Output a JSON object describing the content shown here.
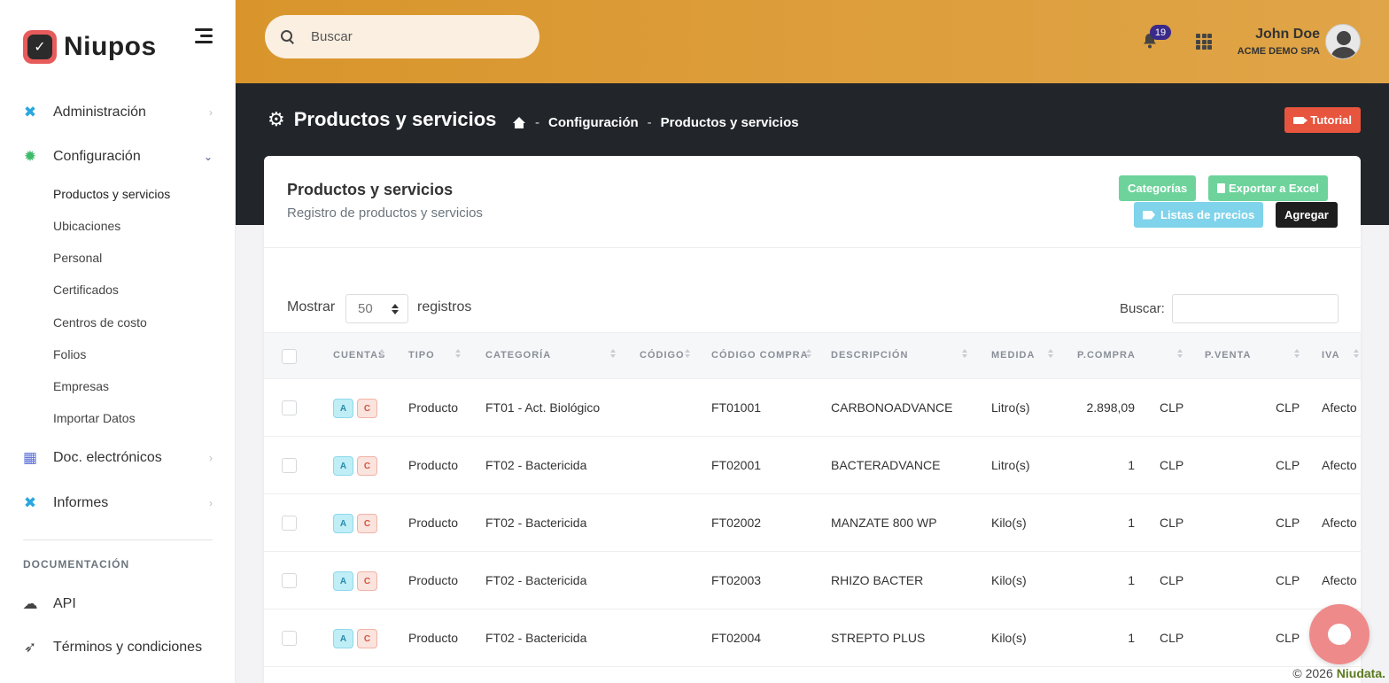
{
  "brand": {
    "name": "Niupos"
  },
  "search": {
    "placeholder": "Buscar"
  },
  "topbar": {
    "notifications": "19",
    "user_name": "John Doe",
    "user_company": "ACME DEMO SPA"
  },
  "sidebar": {
    "items": [
      {
        "label": "Administración"
      },
      {
        "label": "Configuración"
      },
      {
        "label": "Doc. electrónicos"
      },
      {
        "label": "Informes"
      },
      {
        "label": "API"
      },
      {
        "label": "Términos y condiciones"
      }
    ],
    "submenu": [
      "Productos y servicios",
      "Ubicaciones",
      "Personal",
      "Certificados",
      "Centros de costo",
      "Folios",
      "Empresas",
      "Importar Datos"
    ],
    "section_label": "DOCUMENTACIÓN"
  },
  "header": {
    "title": "Productos y servicios",
    "breadcrumb": [
      "Configuración",
      "Productos y servicios"
    ],
    "breadcrumb_sep": "-",
    "tutorial_label": "Tutorial"
  },
  "card": {
    "title": "Productos y servicios",
    "subtitle": "Registro de productos y servicios",
    "buttons": {
      "categories": "Categorías",
      "export": "Exportar a Excel",
      "price_lists": "Listas de precios",
      "add": "Agregar"
    },
    "show_label": "Mostrar",
    "page_length": "50",
    "records_label": "registros",
    "filter_label": "Buscar:"
  },
  "table": {
    "columns": [
      "CUENTAS",
      "TIPO",
      "CATEGORÍA",
      "CÓDIGO",
      "CÓDIGO COMPRA",
      "DESCRIPCIÓN",
      "MEDIDA",
      "P.COMPRA",
      "P.VENTA",
      "IVA"
    ],
    "account_badges": [
      "A",
      "C"
    ],
    "rows": [
      {
        "tipo": "Producto",
        "categoria": "FT01 - Act. Biológico",
        "codigo": "",
        "codigo_compra": "FT01001",
        "descripcion": "CARBONOADVANCE",
        "medida": "Litro(s)",
        "p_compra": "2.898,09",
        "moneda_compra": "CLP",
        "p_venta": "",
        "moneda_venta": "CLP",
        "iva": "Afecto"
      },
      {
        "tipo": "Producto",
        "categoria": "FT02 - Bactericida",
        "codigo": "",
        "codigo_compra": "FT02001",
        "descripcion": "BACTERADVANCE",
        "medida": "Litro(s)",
        "p_compra": "1",
        "moneda_compra": "CLP",
        "p_venta": "",
        "moneda_venta": "CLP",
        "iva": "Afecto"
      },
      {
        "tipo": "Producto",
        "categoria": "FT02 - Bactericida",
        "codigo": "",
        "codigo_compra": "FT02002",
        "descripcion": "MANZATE 800 WP",
        "medida": "Kilo(s)",
        "p_compra": "1",
        "moneda_compra": "CLP",
        "p_venta": "",
        "moneda_venta": "CLP",
        "iva": "Afecto"
      },
      {
        "tipo": "Producto",
        "categoria": "FT02 - Bactericida",
        "codigo": "",
        "codigo_compra": "FT02003",
        "descripcion": "RHIZO BACTER",
        "medida": "Kilo(s)",
        "p_compra": "1",
        "moneda_compra": "CLP",
        "p_venta": "",
        "moneda_venta": "CLP",
        "iva": "Afecto"
      },
      {
        "tipo": "Producto",
        "categoria": "FT02 - Bactericida",
        "codigo": "",
        "codigo_compra": "FT02004",
        "descripcion": "STREPTO PLUS",
        "medida": "Kilo(s)",
        "p_compra": "1",
        "moneda_compra": "CLP",
        "p_venta": "",
        "moneda_venta": "CLP",
        "iva": ""
      }
    ]
  },
  "footer": {
    "copyright": "© 2026",
    "company": "Niudata."
  },
  "colors": {
    "topbar": "#d9952c",
    "dark_header": "#22262b",
    "green_button": "#6dd39b",
    "cyan_button": "#7fd3ea",
    "tutorial": "#e8553f",
    "chat": "#ee8a8a"
  }
}
